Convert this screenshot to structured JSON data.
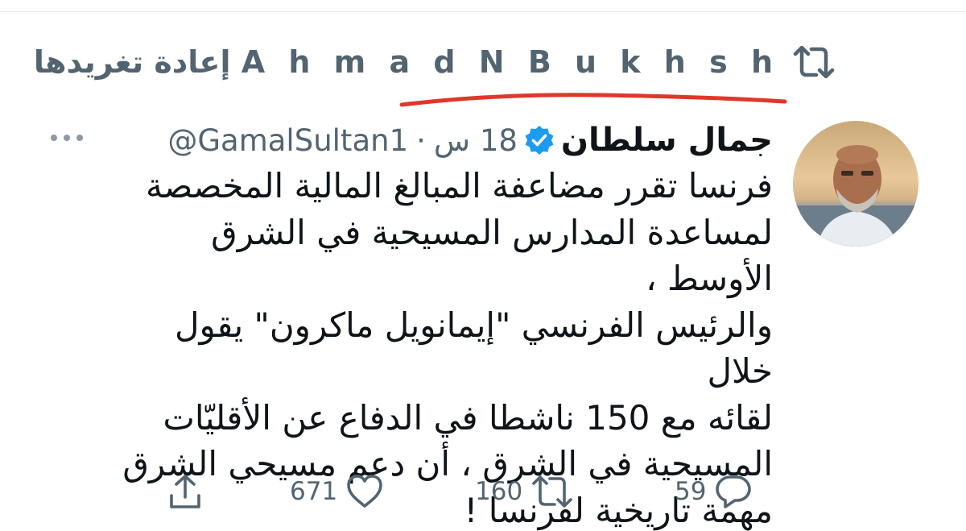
{
  "retweet_context": {
    "retweeter_name": "A h m a d N B u k h s h",
    "label": "إعادة تغريدها"
  },
  "tweet": {
    "display_name": "جمال سلطان",
    "handle": "@GamalSultan1",
    "separator": "·",
    "time": "18 س",
    "body": "فرنسا تقرر مضاعفة المبالغ المالية المخصصة\nلمساعدة المدارس المسيحية في الشرق الأوسط ،\nوالرئيس الفرنسي \"إيمانويل ماكرون\" يقول خلال\nلقائه مع 150 ناشطا في الدفاع عن الأقليّات\nالمسيحية في الشرق ، أن دعم مسيحي الشرق\nمهمة تاريخية لفرنسا !"
  },
  "actions": {
    "reply_count": "59",
    "retweet_count": "160",
    "like_count": "671"
  },
  "colors": {
    "secondary_text": "#536471",
    "verified": "#1d9bf0",
    "annotation_red": "#e0372b"
  },
  "icons": {
    "retweet": "retweet-icon",
    "verified": "verified-badge-icon",
    "more": "more-icon",
    "reply": "reply-icon",
    "like": "heart-icon",
    "share": "share-icon"
  }
}
